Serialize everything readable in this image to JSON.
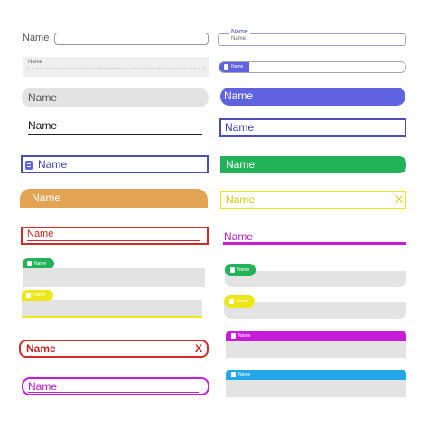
{
  "fields": {
    "f1": {
      "label": "Name"
    },
    "f2": {
      "label": "Name",
      "legend": "Name"
    },
    "f3": {
      "label": "Name"
    },
    "f4": {
      "label": "Name"
    },
    "f5": {
      "label": "Name"
    },
    "f6": {
      "label": "Name"
    },
    "f7": {
      "label": "Name"
    },
    "f8": {
      "label": "Name"
    },
    "f9": {
      "label": "Name"
    },
    "f10": {
      "label": "Name"
    },
    "f11": {
      "label": "Name"
    },
    "f12": {
      "label": "Name",
      "clear": "X"
    },
    "f13": {
      "label": "Name"
    },
    "f14": {
      "label": "Name"
    },
    "f15": {
      "label": "Name"
    },
    "f16": {
      "label": "Name"
    },
    "f17": {
      "label": "Name"
    },
    "f18": {
      "label": "Name"
    },
    "f19": {
      "label": "Name",
      "clear": "X"
    },
    "f20": {
      "label": "Name"
    },
    "f21": {
      "label": "Name"
    },
    "f22": {
      "label": "Name"
    }
  },
  "colors": {
    "gray_border": "#9a9a9a",
    "gray_fill": "#e3e3e3",
    "purple": "#6063e0",
    "navy": "#4a4fb8",
    "green": "#22b257",
    "orange": "#e2a453",
    "yellow": "#ede71a",
    "red": "#d42a2a",
    "magenta": "#c81ad9",
    "cyan": "#23a7e8"
  }
}
